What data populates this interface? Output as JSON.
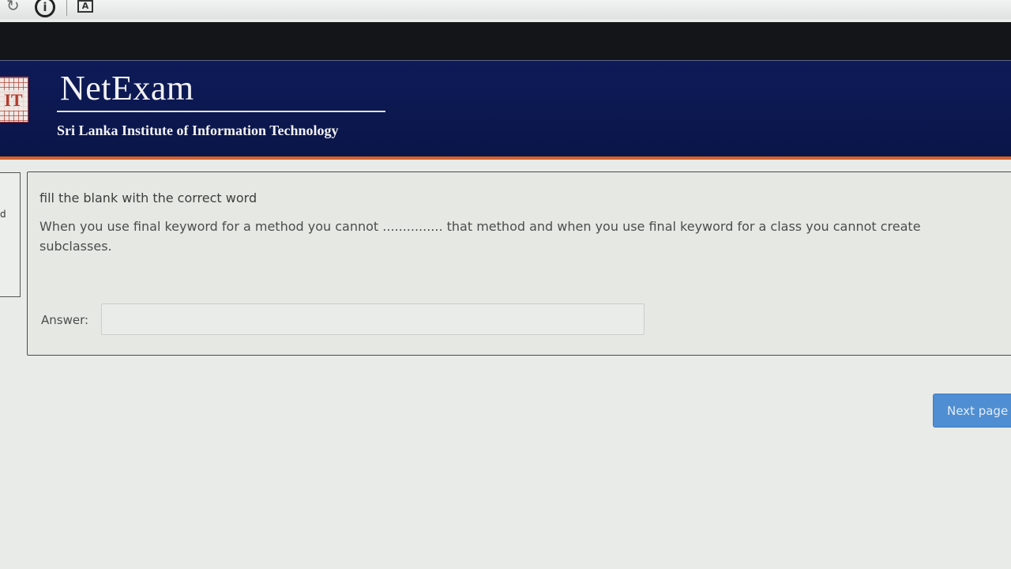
{
  "browser": {
    "reload_icon": "reload-icon",
    "info_icon": "info-icon",
    "info_glyph": "i",
    "translate_icon": "translate-icon",
    "translate_glyph": "A"
  },
  "header": {
    "logo_letters": "IT",
    "brand": "NetExam",
    "institute": "Sri Lanka Institute of Information Technology",
    "bg_color": "#0e1b58",
    "accent_color": "#d9622a"
  },
  "side_panel": {
    "mark": "d"
  },
  "question": {
    "title": "fill the blank with the correct word",
    "text": "When you use final keyword for a method you cannot ............... that method and when you use final keyword for a class you cannot create subclasses.",
    "answer_label": "Answer:",
    "answer_value": ""
  },
  "navigation": {
    "next_label": "Next page",
    "button_color": "#4f8ed2"
  }
}
